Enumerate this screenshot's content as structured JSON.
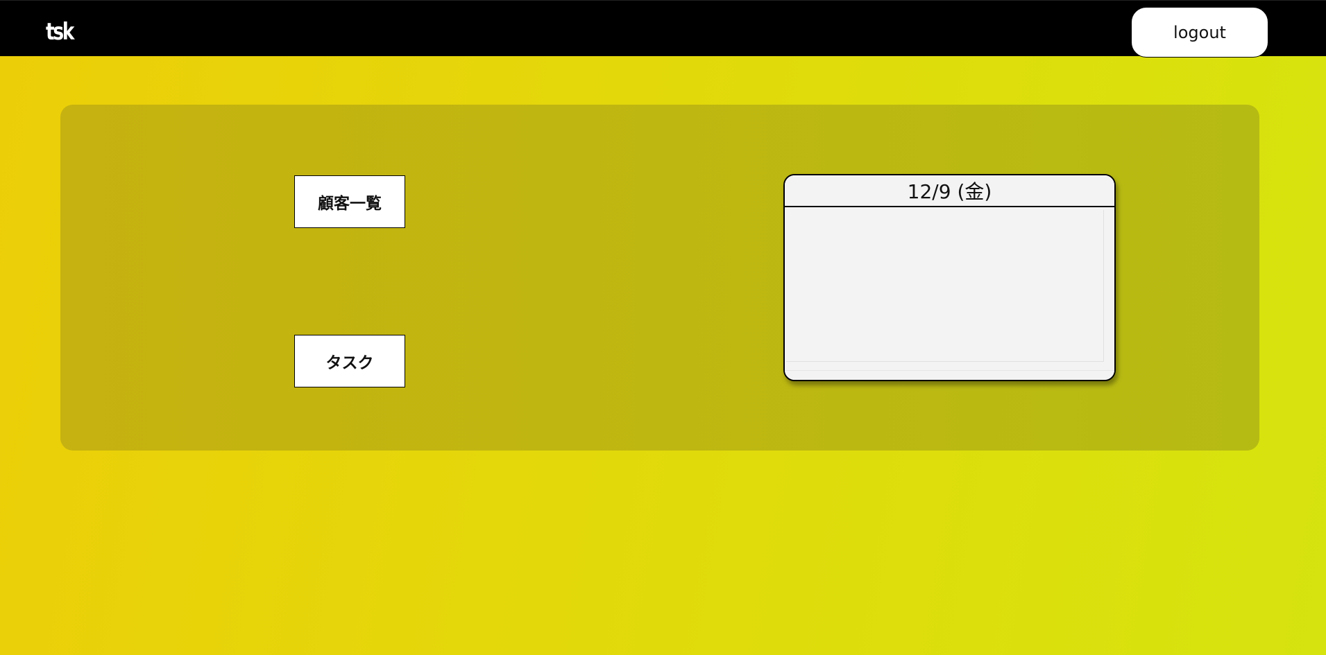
{
  "header": {
    "logo_text": "tsk",
    "logout_label": "logout",
    "background_color": "#000000"
  },
  "main": {
    "nav_buttons": [
      {
        "label": "顧客一覧"
      },
      {
        "label": "タスク"
      }
    ],
    "calendar": {
      "date_label": "12/9 (金)"
    }
  },
  "colors": {
    "background_gradient_start": "#ecce08",
    "background_gradient_end": "#d6e30e",
    "panel": "#bfb711",
    "button_bg": "#ffffff"
  }
}
